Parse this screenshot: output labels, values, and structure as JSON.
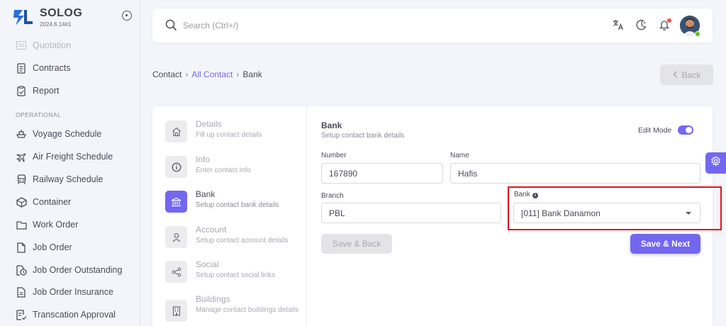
{
  "brand": {
    "name": "SOLOG",
    "version": "2024.6.14#1"
  },
  "sidebar": {
    "items_top": [
      {
        "label": "Quotation",
        "icon": "quotation-icon"
      },
      {
        "label": "Contracts",
        "icon": "contract-icon"
      },
      {
        "label": "Report",
        "icon": "report-icon"
      }
    ],
    "section_label": "OPERATIONAL",
    "items": [
      {
        "label": "Voyage Schedule",
        "icon": "ship-icon"
      },
      {
        "label": "Air Freight Schedule",
        "icon": "plane-icon"
      },
      {
        "label": "Railway Schedule",
        "icon": "train-icon"
      },
      {
        "label": "Container",
        "icon": "container-icon"
      },
      {
        "label": "Work Order",
        "icon": "folder-icon"
      },
      {
        "label": "Job Order",
        "icon": "file-icon"
      },
      {
        "label": "Job Order Outstanding",
        "icon": "file-clock-icon"
      },
      {
        "label": "Job Order Insurance",
        "icon": "file-text-icon"
      },
      {
        "label": "Transcation Approval",
        "icon": "file-check-icon"
      }
    ]
  },
  "search": {
    "placeholder": "Search (Ctrl+/)"
  },
  "breadcrumb": {
    "root": "Contact",
    "parent": "All Contact",
    "current": "Bank"
  },
  "back_label": "Back",
  "steps": [
    {
      "title": "Details",
      "subtitle": "Fill up contact details",
      "icon": "home-icon"
    },
    {
      "title": "Info",
      "subtitle": "Enter contact info",
      "icon": "info-icon"
    },
    {
      "title": "Bank",
      "subtitle": "Setup contact bank details",
      "icon": "bank-icon",
      "active": true
    },
    {
      "title": "Account",
      "subtitle": "Setup contact account details",
      "icon": "user-icon"
    },
    {
      "title": "Social",
      "subtitle": "Setup contact social links",
      "icon": "share-icon"
    },
    {
      "title": "Buildings",
      "subtitle": "Manage contact buildings details",
      "icon": "building-icon"
    }
  ],
  "form": {
    "title": "Bank",
    "subtitle": "Setup contact bank details",
    "edit_mode_label": "Edit Mode",
    "edit_mode_on": true,
    "number_label": "Number",
    "number_value": "167890",
    "name_label": "Name",
    "name_value": "Hafis",
    "branch_label": "Branch",
    "branch_value": "PBL",
    "bank_label": "Bank",
    "bank_value": "[011] Bank Danamon",
    "save_back_label": "Save & Back",
    "save_next_label": "Save & Next"
  },
  "colors": {
    "primary": "#7367f0",
    "highlight": "#e0121e",
    "online": "#56ca00"
  }
}
